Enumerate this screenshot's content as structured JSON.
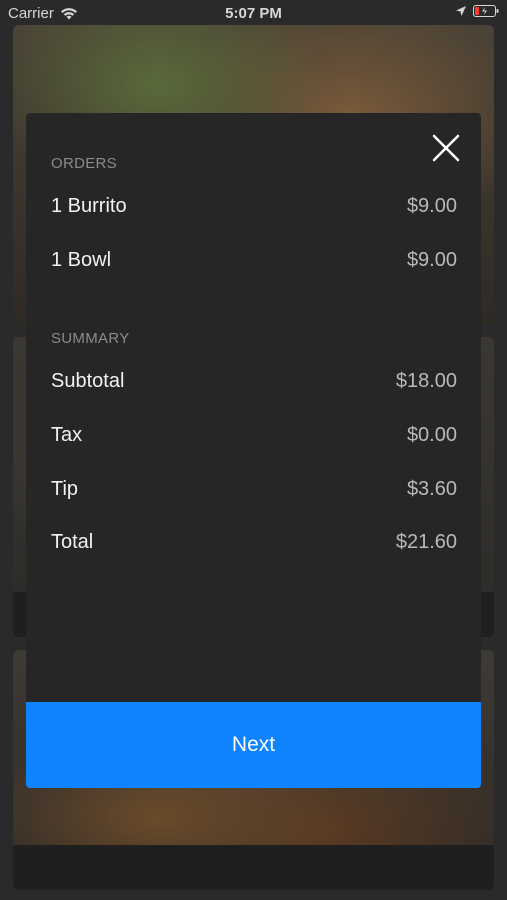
{
  "status_bar": {
    "carrier": "Carrier",
    "time": "5:07 PM"
  },
  "modal": {
    "orders_header": "ORDERS",
    "orders": [
      {
        "label": "1 Burrito",
        "value": "$9.00"
      },
      {
        "label": "1 Bowl",
        "value": "$9.00"
      }
    ],
    "summary_header": "SUMMARY",
    "summary": [
      {
        "label": "Subtotal",
        "value": "$18.00"
      },
      {
        "label": "Tax",
        "value": "$0.00"
      },
      {
        "label": "Tip",
        "value": "$3.60"
      },
      {
        "label": "Total",
        "value": "$21.60"
      }
    ],
    "next_label": "Next",
    "close_icon": "close-icon"
  },
  "colors": {
    "accent": "#0f84fe",
    "modal_bg": "#262626",
    "header_text": "#8b8b8b"
  }
}
